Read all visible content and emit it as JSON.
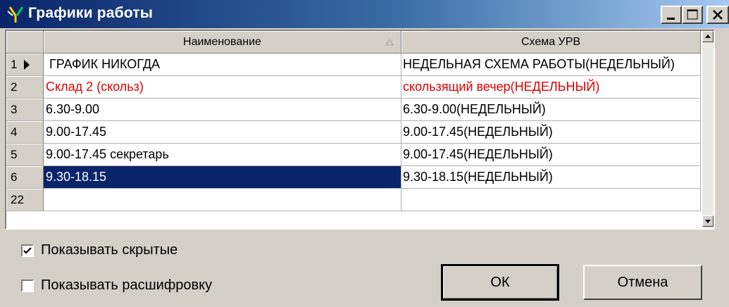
{
  "window": {
    "title": "Графики работы"
  },
  "titlebar_buttons": {
    "minimize_icon": "minimize-icon",
    "maximize_icon": "maximize-icon",
    "close_icon": "close-icon"
  },
  "table": {
    "columns": [
      "Наименование",
      "Схема УРВ"
    ],
    "rows": [
      {
        "num": "1",
        "name": "ГРАФИК НИКОГДА",
        "scheme": "НЕДЕЛЬНАЯ СХЕМА РАБОТЫ(НЕДЕЛЬНЫЙ)",
        "current": true
      },
      {
        "num": "2",
        "name": "Склад 2 (скольз)",
        "scheme": "скользящий вечер(НЕДЕЛЬНЫЙ)",
        "hidden": true
      },
      {
        "num": "3",
        "name": "6.30-9.00",
        "scheme": "6.30-9.00(НЕДЕЛЬНЫЙ)"
      },
      {
        "num": "4",
        "name": "9.00-17.45",
        "scheme": "9.00-17.45(НЕДЕЛЬНЫЙ)"
      },
      {
        "num": "5",
        "name": "9.00-17.45 секретарь",
        "scheme": "9.00-17.45(НЕДЕЛЬНЫЙ)"
      },
      {
        "num": "6",
        "name": "9.30-18.15",
        "scheme": "9.30-18.15(НЕДЕЛЬНЫЙ)",
        "selected": true
      },
      {
        "num": "22",
        "name": "",
        "scheme": ""
      }
    ]
  },
  "options": {
    "show_hidden": {
      "label": "Показывать скрытые",
      "checked": true
    },
    "show_decoding": {
      "label": "Показывать расшифровку",
      "checked": false
    }
  },
  "buttons": {
    "ok": "ОК",
    "cancel": "Отмена"
  },
  "colors": {
    "title_start": "#0a246a",
    "title_end": "#a6caf0",
    "selection": "#0a246a",
    "hidden_row_text": "#e00000"
  }
}
